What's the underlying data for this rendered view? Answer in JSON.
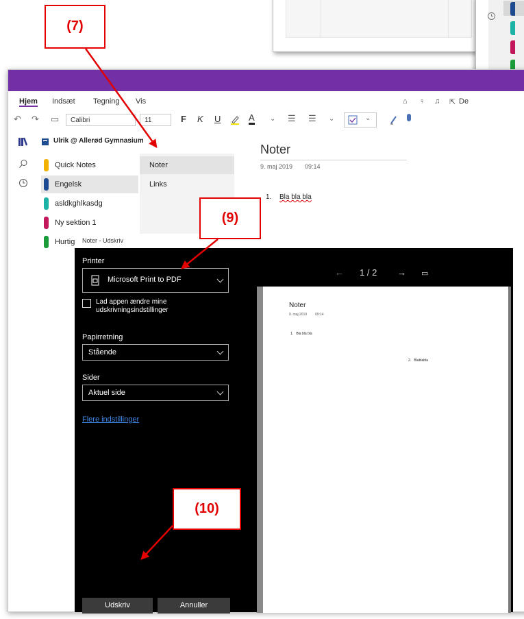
{
  "callouts": {
    "c7": "(7)",
    "c9": "(9)",
    "c10": "(10)"
  },
  "menu": {
    "hjem": "Hjem",
    "indsaet": "Indsæt",
    "tegning": "Tegning",
    "vis": "Vis",
    "share": "De"
  },
  "toolbar": {
    "font": "Calibri",
    "size": "11",
    "bold": "F",
    "italic": "K",
    "underline": "U",
    "text_color": "A"
  },
  "notebook": {
    "name": "Ulrik @ Allerød Gymnasium"
  },
  "sections": [
    {
      "label": "Quick Notes",
      "color": "#f2b300"
    },
    {
      "label": "Engelsk",
      "color": "#1e4b8f"
    },
    {
      "label": "asldkghlkasdg",
      "color": "#1ab3a6"
    },
    {
      "label": "Ny sektion 1",
      "color": "#c2185b"
    },
    {
      "label": "Hurtige",
      "color": "#1a9c3a"
    }
  ],
  "pages": [
    "Noter",
    "Links"
  ],
  "note": {
    "title": "Noter",
    "date": "9. maj 2019",
    "time": "09:14",
    "item_num": "1.",
    "item_text": "Bla bla bla"
  },
  "dialog": {
    "title": "Noter - Udskriv",
    "printer_label": "Printer",
    "printer_value": "Microsoft Print to PDF",
    "checkbox_label": "Lad appen ændre mine udskrivningsindstillinger",
    "orientation_label": "Papirretning",
    "orientation_value": "Stående",
    "pages_label": "Sider",
    "pages_value": "Aktuel side",
    "more_link": "Flere indstillinger",
    "print_button": "Udskriv",
    "cancel_button": "Annuller"
  },
  "preview": {
    "page_indicator": "1 / 2",
    "doc_title": "Noter",
    "doc_date": "9. maj 2019",
    "doc_time": "09:14",
    "line1": "1.   Bla bla bla",
    "line2": "2.   Blablabla"
  },
  "colors": {
    "accent_purple": "#7330a6",
    "callout_red": "#e20000",
    "link_blue": "#3f87e6"
  }
}
